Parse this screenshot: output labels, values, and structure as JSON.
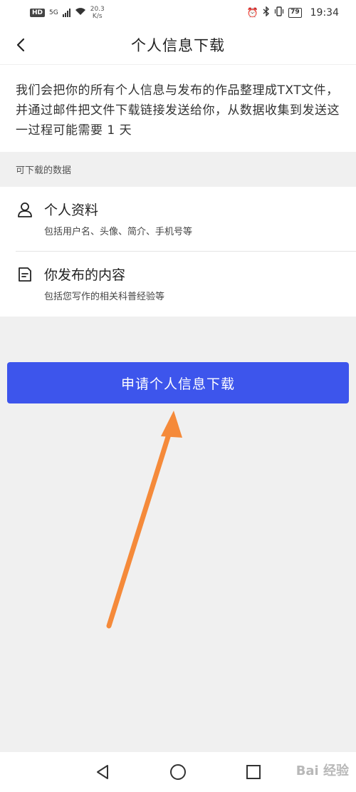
{
  "status_bar": {
    "hd": "HD",
    "network": "5G",
    "speed_value": "20.3",
    "speed_unit": "K/s",
    "battery": "79",
    "time": "19:34"
  },
  "nav": {
    "title": "个人信息下载"
  },
  "intro": {
    "text": "我们会把你的所有个人信息与发布的作品整理成TXT文件，并通过邮件把文件下载链接发送给你，从数据收集到发送这一过程可能需要 1 天"
  },
  "section": {
    "label": "可下载的数据"
  },
  "items": [
    {
      "title": "个人资料",
      "desc": "包括用户名、头像、简介、手机号等",
      "icon": "person-icon"
    },
    {
      "title": "你发布的内容",
      "desc": "包括您写作的相关科普经验等",
      "icon": "document-icon"
    }
  ],
  "apply_button": {
    "label": "申请个人信息下载"
  },
  "colors": {
    "primary": "#3d55ec",
    "arrow": "#f58a3a",
    "background": "#f0f0f0"
  },
  "watermark": {
    "text": "Bai 经验"
  }
}
